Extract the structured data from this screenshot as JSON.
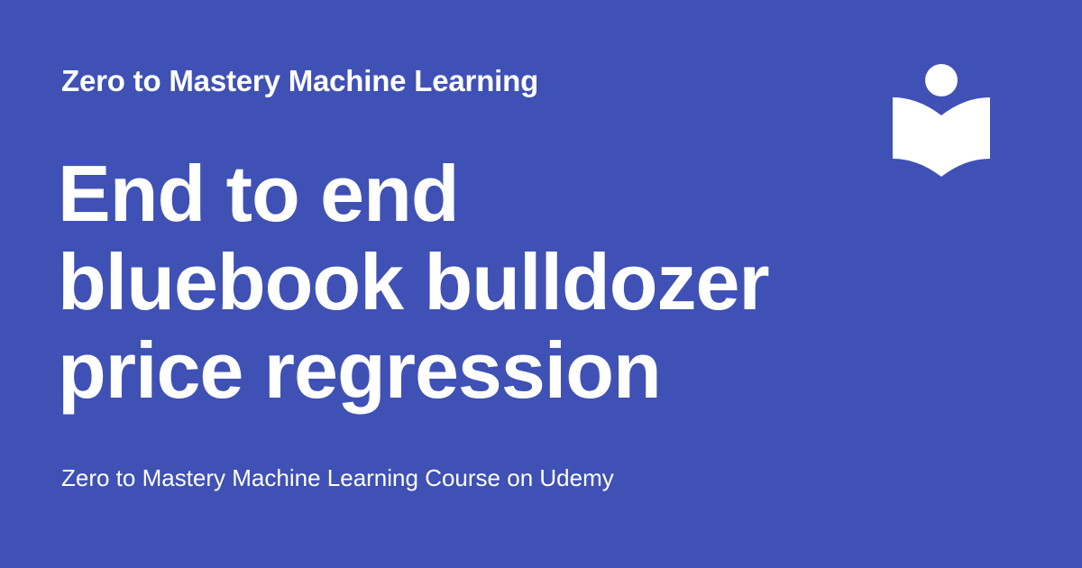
{
  "header": {
    "site_name": "Zero to Mastery Machine Learning"
  },
  "main": {
    "title_lines": [
      "End to end",
      "bluebook bulldozer",
      "price regression"
    ]
  },
  "footer": {
    "description": "Zero to Mastery Machine Learning Course on Udemy"
  },
  "logo": {
    "icon": "reader-book-icon"
  },
  "colors": {
    "background": "#3f51b5",
    "text": "#ffffff"
  }
}
